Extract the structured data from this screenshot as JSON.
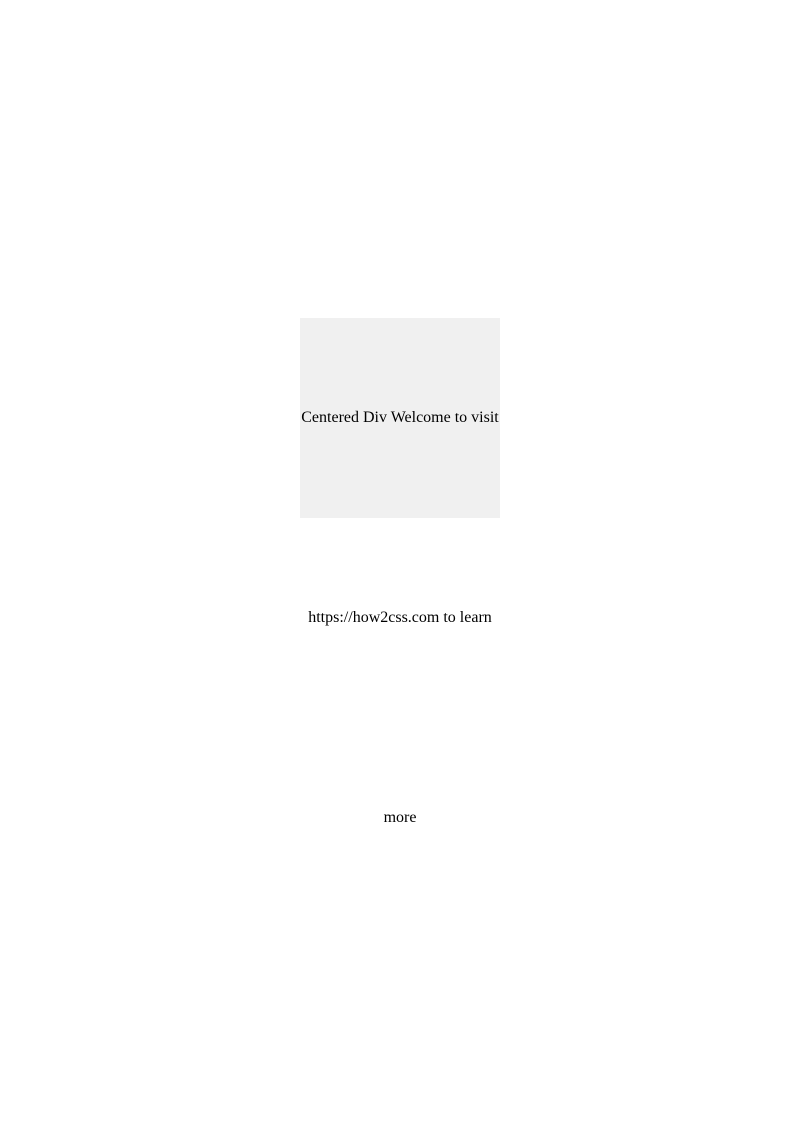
{
  "line1": "Centered Div Welcome to visit",
  "line2": "https://how2css.com to learn",
  "line3": "more"
}
